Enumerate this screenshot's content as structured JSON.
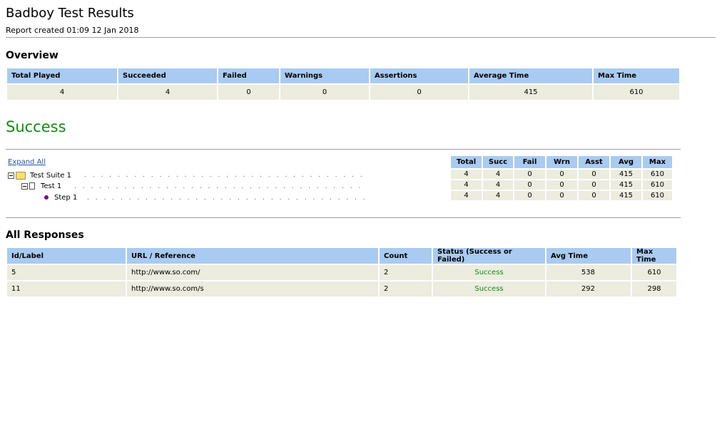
{
  "header": {
    "title": "Badboy Test Results",
    "created": "Report created 01:09 12 Jan 2018"
  },
  "overview": {
    "heading": "Overview",
    "columns": [
      "Total Played",
      "Succeeded",
      "Failed",
      "Warnings",
      "Assertions",
      "Average Time",
      "Max Time"
    ],
    "values": [
      "4",
      "4",
      "0",
      "0",
      "0",
      "415",
      "610"
    ]
  },
  "status": "Success",
  "tree": {
    "expand_all": "Expand All",
    "items": [
      {
        "label": "Test Suite 1"
      },
      {
        "label": "Test 1"
      },
      {
        "label": "Step 1"
      }
    ],
    "leaders": ". . . . . . . . . . . . . . . . . . . . . . . . . . . . . . . . . . . . . . . . . . . . . . . . . . . . . . ."
  },
  "summary_table": {
    "columns": [
      "Total",
      "Succ",
      "Fail",
      "Wrn",
      "Asst",
      "Avg",
      "Max"
    ],
    "rows": [
      [
        "4",
        "4",
        "0",
        "0",
        "0",
        "415",
        "610"
      ],
      [
        "4",
        "4",
        "0",
        "0",
        "0",
        "415",
        "610"
      ],
      [
        "4",
        "4",
        "0",
        "0",
        "0",
        "415",
        "610"
      ]
    ]
  },
  "responses": {
    "heading": "All Responses",
    "columns": [
      "Id/Label",
      "URL / Reference",
      "Count",
      "Status (Success or Failed)",
      "Avg Time",
      "Max Time"
    ],
    "rows": [
      [
        "5",
        "http://www.so.com/",
        "2",
        "Success",
        "538",
        "610"
      ],
      [
        "11",
        "http://www.so.com/s",
        "2",
        "Success",
        "292",
        "298"
      ]
    ]
  },
  "colors": {
    "header_bg": "#a9cbf1",
    "cell_bg": "#ececdf",
    "success": "#128b12",
    "link": "#2955a3"
  }
}
